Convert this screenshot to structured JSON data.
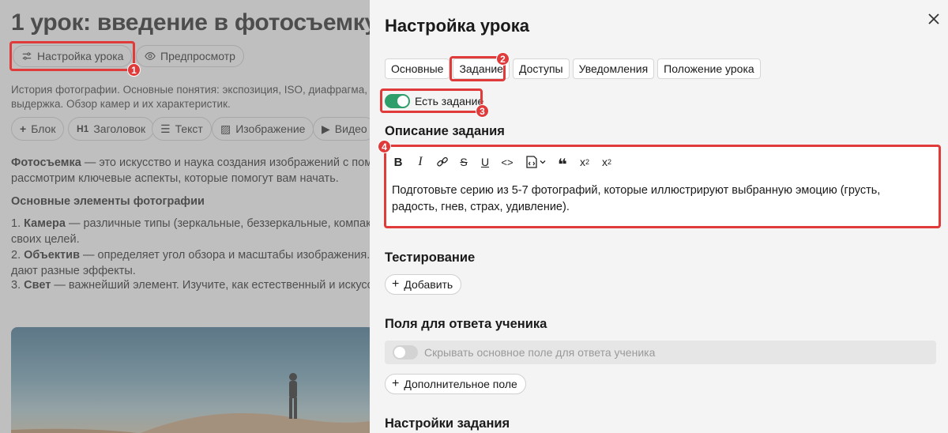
{
  "lesson": {
    "title": "1 урок: введение в фотосъемку",
    "settings_button": "Настройка урока",
    "preview_button": "Предпросмотр",
    "description": "История фотографии. Основные понятия: экспозиция, ISO, диафрагма, выдержка. Обзор камер и их характеристик.",
    "toolbar": [
      {
        "icon": "plus-icon",
        "label": "Блок"
      },
      {
        "icon": "heading-icon",
        "glyph": "H1",
        "label": "Заголовок"
      },
      {
        "icon": "text-icon",
        "label": "Текст"
      },
      {
        "icon": "image-icon",
        "label": "Изображение"
      },
      {
        "icon": "video-icon",
        "label": "Видео"
      }
    ],
    "intro_bold": "Фотосъемка",
    "intro_rest": " — это искусство и наука создания изображений с помощью света. В этом уроке мы",
    "intro_line2": "рассмотрим ключевые аспекты, которые помогут вам начать.",
    "elements_heading": "Основные элементы фотографии",
    "list": [
      {
        "num": "1. ",
        "bold": "Камера",
        "rest": " — различные типы (зеркальные, беззеркальные, компактные). Выберите подходящую для",
        "line2": "своих целей."
      },
      {
        "num": "2. ",
        "bold": "Объектив",
        "rest": " — определяет угол обзора и масштабы изображения. Разные объективы",
        "line2": "дают разные эффекты."
      },
      {
        "num": "3. ",
        "bold": "Свет",
        "rest": " — важнейший элемент. Изучите, как естественный и искусственный свет"
      }
    ]
  },
  "drawer": {
    "title": "Настройка урока",
    "tabs": [
      "Основные",
      "Задание",
      "Доступы",
      "Уведомления",
      "Положение урока"
    ],
    "active_tab": "Задание",
    "has_task_toggle": {
      "label": "Есть задание",
      "on": true
    },
    "task_description_title": "Описание задания",
    "editor_text": "Подготовьте серию из 5-7 фотографий, которые иллюстрируют выбранную эмоцию (грусть, радость, гнев, страх, удивление).",
    "testing_title": "Тестирование",
    "add_button": "Добавить",
    "answer_fields_title": "Поля для ответа ученика",
    "hide_main_field": {
      "label": "Скрывать основное поле для ответа ученика",
      "on": false
    },
    "extra_field_button": "Дополнительное поле",
    "task_settings_title": "Настройки задания"
  },
  "callouts": [
    "1",
    "2",
    "3",
    "4"
  ],
  "colors": {
    "accent_green": "#2e9e6b",
    "callout_red": "#e03a3a"
  }
}
